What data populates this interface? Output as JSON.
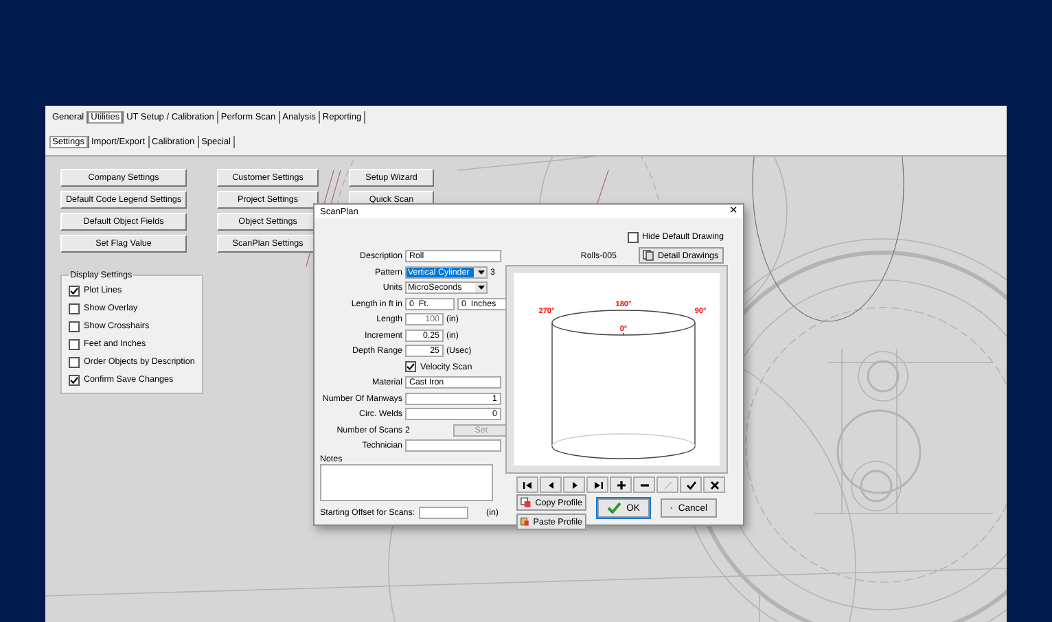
{
  "main_tabs": [
    {
      "label": "General",
      "selected": false
    },
    {
      "label": "Utilities",
      "selected": true
    },
    {
      "label": "UT Setup / Calibration",
      "selected": false
    },
    {
      "label": "Perform Scan",
      "selected": false
    },
    {
      "label": "Analysis",
      "selected": false
    },
    {
      "label": "Reporting",
      "selected": false
    }
  ],
  "sub_tabs": [
    {
      "label": "Settings",
      "selected": true
    },
    {
      "label": "Import/Export",
      "selected": false
    },
    {
      "label": "Calibration",
      "selected": false
    },
    {
      "label": "Special",
      "selected": false
    }
  ],
  "button_columns": [
    {
      "buttons": [
        "Company Settings",
        "Default Code Legend Settings",
        "Default Object Fields",
        "Set Flag Value"
      ]
    },
    {
      "buttons": [
        "Customer Settings",
        "Project Settings",
        "Object Settings",
        "ScanPlan Settings"
      ]
    },
    {
      "buttons": [
        "Setup Wizard",
        "Quick Scan"
      ]
    }
  ],
  "display_settings": {
    "title": "Display Settings",
    "options": [
      {
        "label": "Plot Lines",
        "checked": true
      },
      {
        "label": "Show Overlay",
        "checked": false
      },
      {
        "label": "Show Crosshairs",
        "checked": false
      },
      {
        "label": "Feet and Inches",
        "checked": false
      },
      {
        "label": "Order Objects by Description",
        "checked": false
      },
      {
        "label": "Confirm Save Changes",
        "checked": true
      }
    ]
  },
  "dialog": {
    "title": "ScanPlan",
    "close": "×",
    "fields": [
      {
        "kind": "text",
        "label": "Description",
        "value": "Roll"
      },
      {
        "kind": "select",
        "label": "Pattern",
        "value": "Vertical Cylinder",
        "selected": true,
        "note": "3"
      },
      {
        "kind": "select",
        "label": "Units",
        "value": "MicroSeconds",
        "selected": false
      },
      {
        "kind": "pair",
        "label": "Length in ft in",
        "values": [
          "0  Ft.",
          "0  Inches"
        ]
      },
      {
        "kind": "unit",
        "label": "Length",
        "value": "100",
        "unit": "(in)",
        "disabled": true
      },
      {
        "kind": "unit",
        "label": "Increment",
        "value": "0.25",
        "unit": "(in)",
        "disabled": false
      },
      {
        "kind": "unit",
        "label": "Depth Range",
        "value": "25",
        "unit": "(Usec)",
        "disabled": false
      },
      {
        "kind": "checkbox",
        "label": "Velocity Scan",
        "checked": true
      },
      {
        "kind": "text",
        "label": "Material",
        "value": "Cast Iron"
      },
      {
        "kind": "numeric",
        "label": "Number Of Manways",
        "value": "1"
      },
      {
        "kind": "numeric",
        "label": "Circ. Welds",
        "value": "0"
      },
      {
        "kind": "count",
        "label": "Number of Scans",
        "value": "2",
        "button": "Set",
        "disabled": true
      },
      {
        "kind": "text",
        "label": "Technician"
      }
    ],
    "notes_label": "Notes",
    "offset": {
      "label": "Starting Offset for Scans:",
      "unit": "(in)"
    },
    "hide_default_drawing": {
      "label": "Hide Default Drawing",
      "checked": false
    },
    "drawing_name": "Rolls-005",
    "detail_button": "Detail Drawings",
    "angle_labels": [
      "180°",
      "270°",
      "90°",
      "0°"
    ],
    "navigator": [
      {
        "kind": "first",
        "disabled": false
      },
      {
        "kind": "prev",
        "disabled": false
      },
      {
        "kind": "next",
        "disabled": false
      },
      {
        "kind": "last",
        "disabled": false
      },
      {
        "kind": "add",
        "disabled": false
      },
      {
        "kind": "remove",
        "disabled": false
      },
      {
        "kind": "edit",
        "disabled": true
      },
      {
        "kind": "post",
        "disabled": false
      },
      {
        "kind": "cancel",
        "disabled": false
      }
    ],
    "copy_button": "Copy Profile",
    "paste_button": "Paste Profile",
    "ok_button": "OK",
    "cancel_button": "Cancel"
  }
}
